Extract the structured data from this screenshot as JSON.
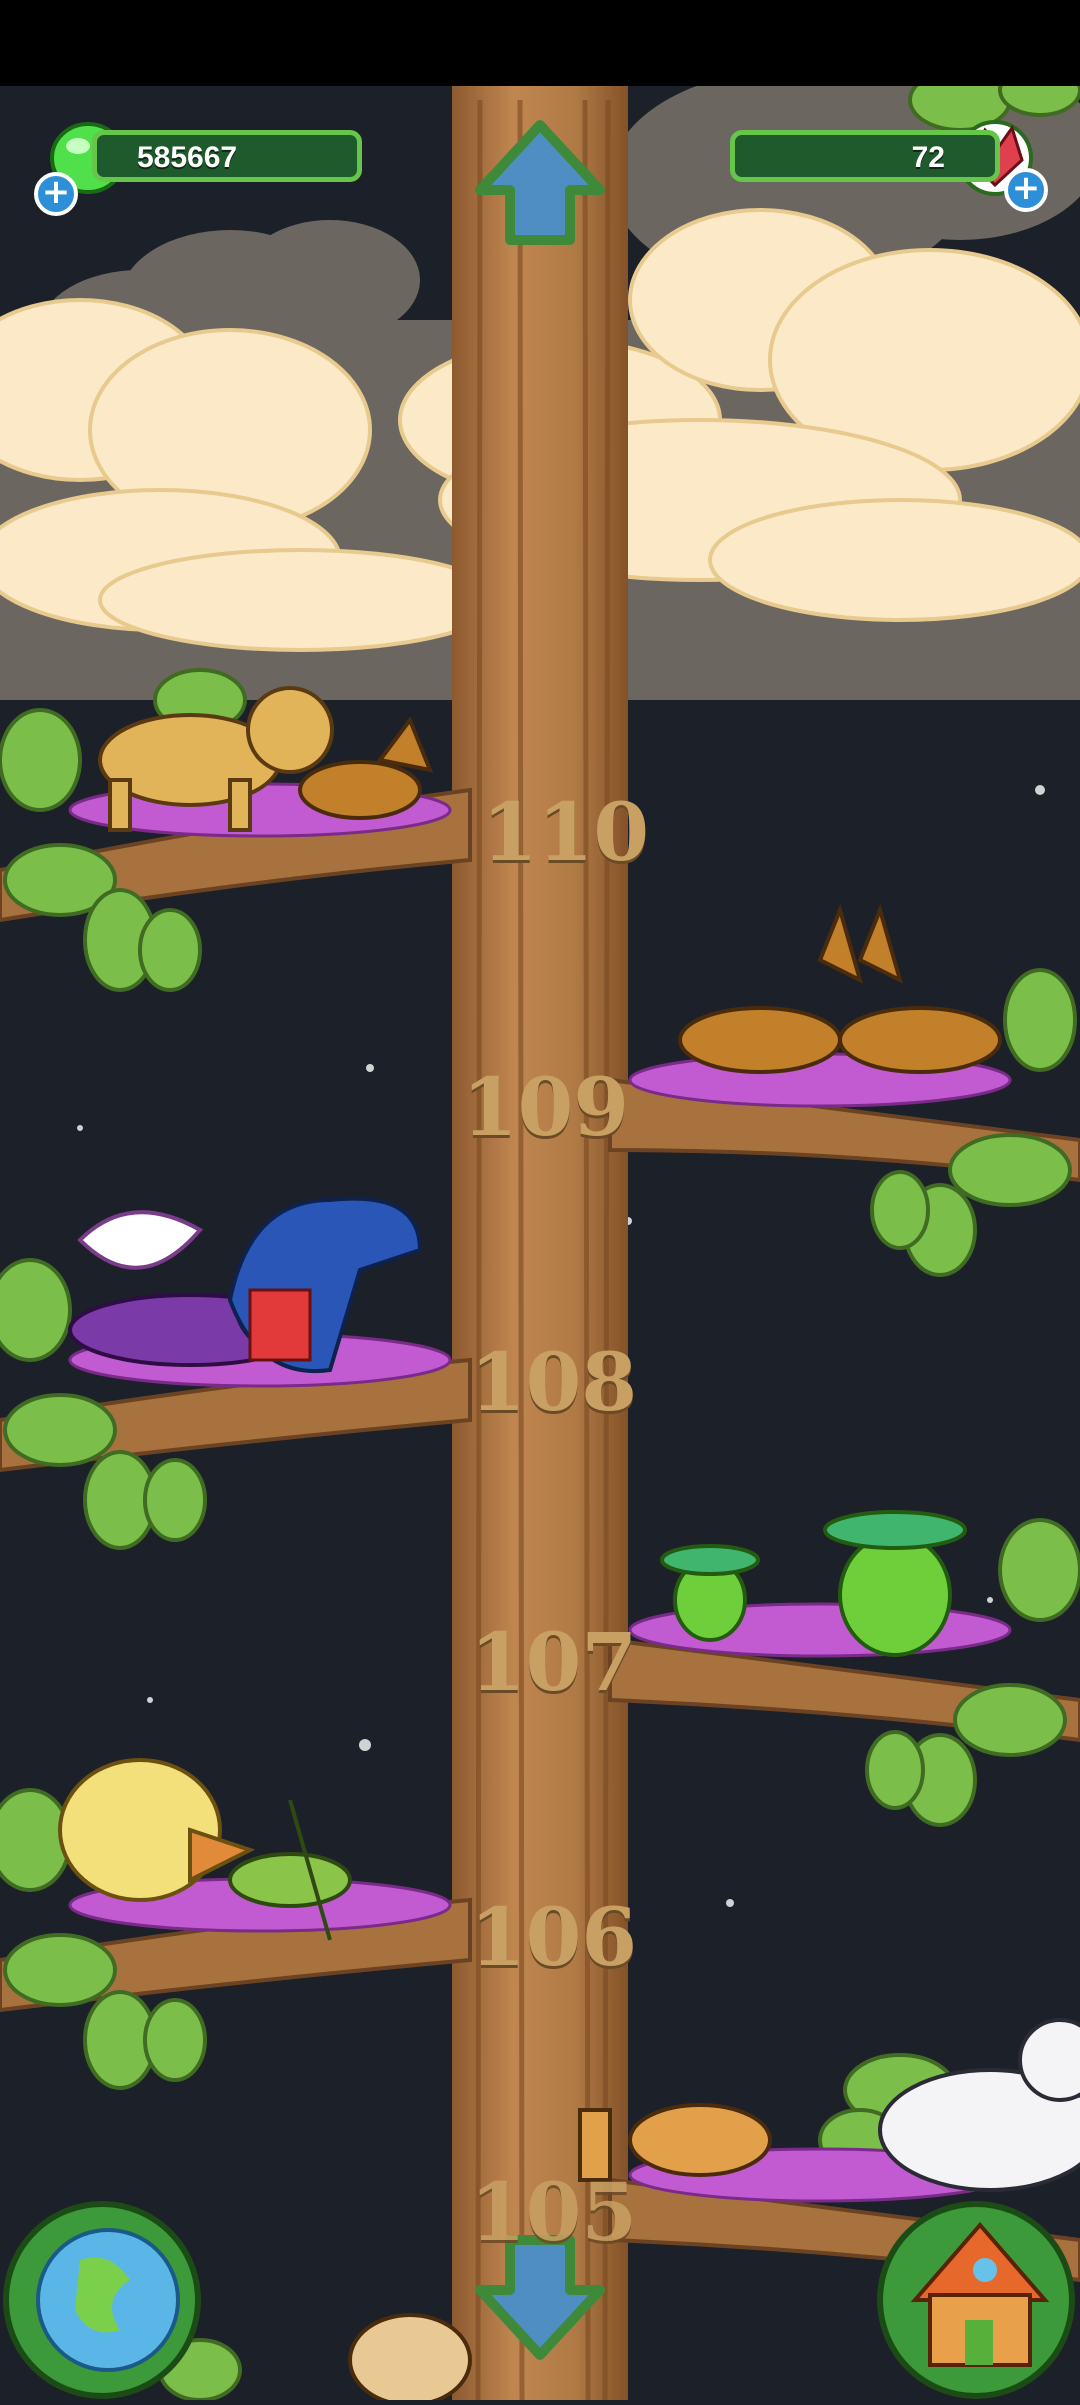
{
  "currency": {
    "gems_green_value": "585667",
    "gems_red_value": "72"
  },
  "branches": [
    {
      "level": "110"
    },
    {
      "level": "109"
    },
    {
      "level": "108"
    },
    {
      "level": "107"
    },
    {
      "level": "106"
    },
    {
      "level": "105"
    }
  ],
  "icons": {
    "up": "arrow-up-icon",
    "down": "arrow-down-icon",
    "globe": "globe-icon",
    "home": "house-icon",
    "green_gem": "green-gem-icon",
    "red_gem": "red-gem-icon"
  },
  "colors": {
    "sky": "#1c2028",
    "trunk": "#b07a45",
    "leaf": "#7bbf4a",
    "accent_green": "#65c64a",
    "plus_blue": "#2d8fd8"
  }
}
